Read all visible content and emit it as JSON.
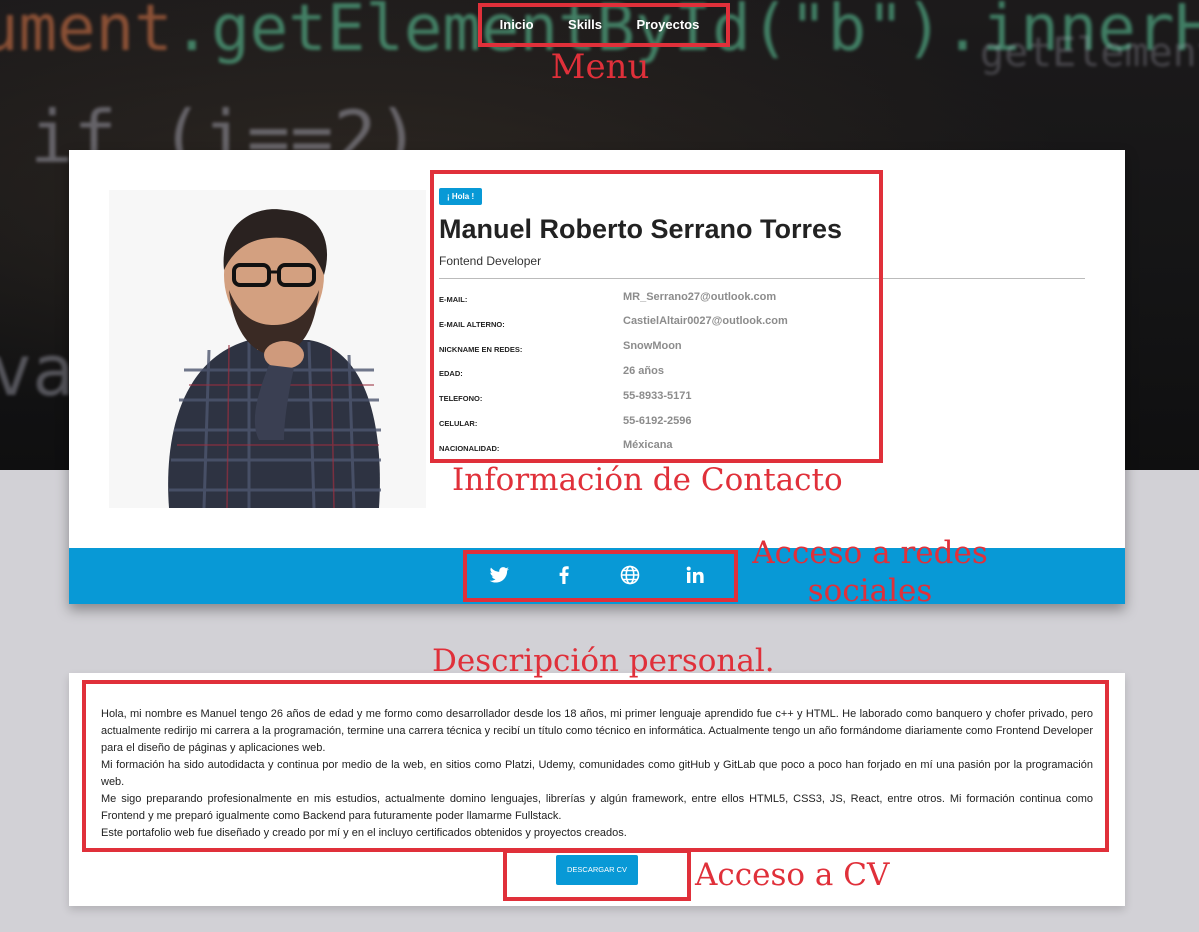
{
  "nav": {
    "items": [
      "Inicio",
      "Skills",
      "Proyectos"
    ]
  },
  "hero_code": {
    "line1a": "ument",
    "line1b": ".getElementById(\"b\").innerHTML",
    "line2": "if (i==2)",
    "line3": "va",
    "line4": "getElement"
  },
  "annotations": {
    "menu": "Menu",
    "contact": "Información de Contacto",
    "social": "Acceso a redes sociales",
    "description": "Descripción personal.",
    "cv": "Acceso a CV"
  },
  "profile": {
    "greeting": "¡ Hola !",
    "name": "Manuel Roberto Serrano Torres",
    "role": "Fontend Developer",
    "info": [
      {
        "label": "E-MAIL:",
        "value": "MR_Serrano27@outlook.com"
      },
      {
        "label": "E-MAIL ALTERNO:",
        "value": "CastielAltair0027@outlook.com"
      },
      {
        "label": "NICKNAME EN REDES:",
        "value": "SnowMoon"
      },
      {
        "label": "EDAD:",
        "value": "26 años"
      },
      {
        "label": "TELEFONO:",
        "value": "55-8933-5171"
      },
      {
        "label": "CELULAR:",
        "value": "55-6192-2596"
      },
      {
        "label": "NACIONALIDAD:",
        "value": "Méxicana"
      }
    ]
  },
  "social": {
    "icons": [
      "twitter-icon",
      "facebook-icon",
      "globe-icon",
      "linkedin-icon"
    ]
  },
  "description": {
    "paragraphs": [
      "Hola, mi nombre es Manuel tengo 26 años de edad y me formo como desarrollador desde los 18 años, mi primer lenguaje aprendido fue c++ y HTML. He laborado como banquero y chofer privado, pero actualmente redirijo mi carrera a la programación, termine una carrera técnica y recibí un título como técnico en informática. Actualmente tengo un año formándome diariamente como Frontend Developer para el diseño de páginas y aplicaciones web.",
      "Mi formación ha sido autodidacta y continua por medio de la web, en sitios como Platzi, Udemy, comunidades como gitHub y GitLab que poco a poco han forjado en mí una pasión por la programación web.",
      "Me sigo preparando profesionalmente en mis estudios, actualmente domino lenguajes, librerías y algún framework, entre ellos HTML5, CSS3, JS, React, entre otros. Mi formación continua como Frontend y me preparó igualmente como Backend para futuramente poder llamarme Fullstack.",
      "Este portafolio web fue diseñado y creado por mí y en el incluyo certificados obtenidos y proyectos creados."
    ],
    "cv_button": "DESCARGAR CV"
  },
  "colors": {
    "accent": "#0899d6",
    "annotation": "#e0303a"
  }
}
